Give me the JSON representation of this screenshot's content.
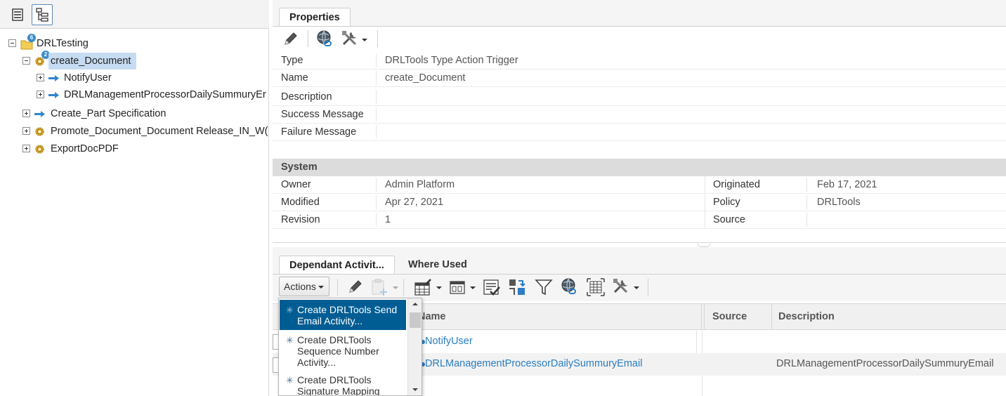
{
  "tree": {
    "root": {
      "label": "DRLTesting",
      "badge": "6"
    },
    "items": [
      {
        "label": "create_Document",
        "badge": "2",
        "selected": true
      },
      {
        "label": "NotifyUser"
      },
      {
        "label": "DRLManagementProcessorDailySummuryEr"
      },
      {
        "label": "Create_Part Specification"
      },
      {
        "label": "Promote_Document_Document Release_IN_W("
      },
      {
        "label": "ExportDocPDF"
      }
    ]
  },
  "properties_tab": {
    "label": "Properties"
  },
  "properties": [
    {
      "label": "Type",
      "value": "DRLTools Type Action Trigger"
    },
    {
      "label": "Name",
      "value": "create_Document"
    },
    {
      "label": "Description",
      "value": ""
    },
    {
      "label": "Success Message",
      "value": ""
    },
    {
      "label": "Failure Message",
      "value": ""
    }
  ],
  "system": {
    "title": "System",
    "rows": [
      {
        "label": "Owner",
        "value": "Admin Platform",
        "label2": "Originated",
        "value2": "Feb 17, 2021"
      },
      {
        "label": "Modified",
        "value": "Apr 27, 2021",
        "label2": "Policy",
        "value2": "DRLTools"
      },
      {
        "label": "Revision",
        "value": "1",
        "label2": "Source",
        "value2": ""
      }
    ]
  },
  "bottom_tabs": [
    {
      "label": "Dependant Activit...",
      "active": true
    },
    {
      "label": "Where Used",
      "active": false
    }
  ],
  "actions_button": "Actions",
  "grid": {
    "columns": [
      "Name",
      "Source",
      "Description"
    ],
    "rows": [
      {
        "name": "NotifyUser",
        "source": "",
        "description": ""
      },
      {
        "name": "DRLManagementProcessorDailySummuryEmail",
        "source": "",
        "description": "DRLManagementProcessorDailySummuryEmail"
      }
    ]
  },
  "menu": {
    "items": [
      {
        "label": "Create DRLTools Send Email Activity...",
        "lines": [
          "Create DRLTools Send",
          "Email Activity..."
        ],
        "highlighted": true
      },
      {
        "label": "Create DRLTools Sequence Number Activity...",
        "lines": [
          "Create DRLTools",
          "Sequence Number",
          "Activity..."
        ]
      },
      {
        "label": "Create DRLTools Signature Mapping",
        "lines": [
          "Create DRLTools",
          "Signature Mapping"
        ]
      }
    ]
  },
  "colors": {
    "accent": "#005d93",
    "link": "#2a7ec2",
    "selection": "#c6dcf2",
    "badge": "#3a8ccd"
  }
}
